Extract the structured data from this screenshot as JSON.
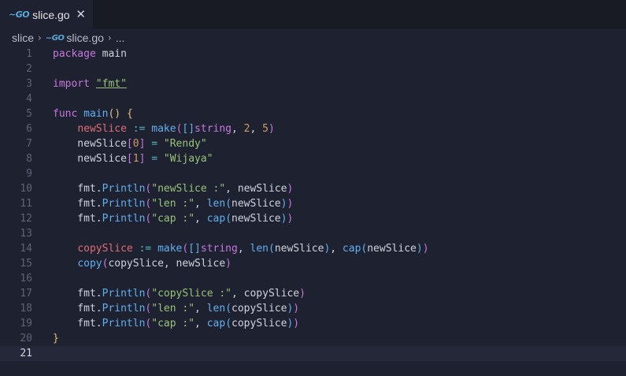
{
  "tab": {
    "icon": "go-file-icon",
    "title": "slice.go",
    "close": "✕"
  },
  "breadcrumb": {
    "folder": "slice",
    "file": "slice.go",
    "more": "..."
  },
  "editor": {
    "current_line": 21,
    "lines": [
      {
        "n": "1",
        "tokens": [
          [
            "kw",
            "package"
          ],
          [
            "pl",
            " main"
          ]
        ]
      },
      {
        "n": "2",
        "tokens": []
      },
      {
        "n": "3",
        "tokens": [
          [
            "kw",
            "import"
          ],
          [
            "pl",
            " "
          ],
          [
            "str",
            "\"fmt\""
          ]
        ]
      },
      {
        "n": "4",
        "tokens": []
      },
      {
        "n": "5",
        "tokens": [
          [
            "kw",
            "func"
          ],
          [
            "pl",
            " "
          ],
          [
            "fn",
            "main"
          ],
          [
            "paren",
            "()"
          ],
          [
            "pl",
            " "
          ],
          [
            "paren",
            "{"
          ]
        ]
      },
      {
        "n": "6",
        "tokens": [
          [
            "pl",
            "    "
          ],
          [
            "var",
            "newSlice"
          ],
          [
            "pl",
            " "
          ],
          [
            "op",
            ":="
          ],
          [
            "pl",
            " "
          ],
          [
            "fn",
            "make"
          ],
          [
            "br2",
            "("
          ],
          [
            "br3",
            "[]"
          ],
          [
            "kw",
            "string"
          ],
          [
            "pl",
            ", "
          ],
          [
            "num",
            "2"
          ],
          [
            "pl",
            ", "
          ],
          [
            "num",
            "5"
          ],
          [
            "br2",
            ")"
          ]
        ]
      },
      {
        "n": "7",
        "tokens": [
          [
            "pl",
            "    newSlice"
          ],
          [
            "br2",
            "["
          ],
          [
            "num",
            "0"
          ],
          [
            "br2",
            "]"
          ],
          [
            "pl",
            " "
          ],
          [
            "op",
            "="
          ],
          [
            "pl",
            " "
          ],
          [
            "str",
            "\"Rendy\""
          ]
        ]
      },
      {
        "n": "8",
        "tokens": [
          [
            "pl",
            "    newSlice"
          ],
          [
            "br2",
            "["
          ],
          [
            "num",
            "1"
          ],
          [
            "br2",
            "]"
          ],
          [
            "pl",
            " "
          ],
          [
            "op",
            "="
          ],
          [
            "pl",
            " "
          ],
          [
            "str",
            "\"Wijaya\""
          ]
        ]
      },
      {
        "n": "9",
        "tokens": []
      },
      {
        "n": "10",
        "tokens": [
          [
            "pl",
            "    fmt."
          ],
          [
            "fn",
            "Println"
          ],
          [
            "br2",
            "("
          ],
          [
            "str",
            "\"newSlice :\""
          ],
          [
            "pl",
            ", newSlice"
          ],
          [
            "br2",
            ")"
          ]
        ]
      },
      {
        "n": "11",
        "tokens": [
          [
            "pl",
            "    fmt."
          ],
          [
            "fn",
            "Println"
          ],
          [
            "br2",
            "("
          ],
          [
            "str",
            "\"len :\""
          ],
          [
            "pl",
            ", "
          ],
          [
            "fn",
            "len"
          ],
          [
            "br3",
            "("
          ],
          [
            "pl",
            "newSlice"
          ],
          [
            "br3",
            ")"
          ],
          [
            "br2",
            ")"
          ]
        ]
      },
      {
        "n": "12",
        "tokens": [
          [
            "pl",
            "    fmt."
          ],
          [
            "fn",
            "Println"
          ],
          [
            "br2",
            "("
          ],
          [
            "str",
            "\"cap :\""
          ],
          [
            "pl",
            ", "
          ],
          [
            "fn",
            "cap"
          ],
          [
            "br3",
            "("
          ],
          [
            "pl",
            "newSlice"
          ],
          [
            "br3",
            ")"
          ],
          [
            "br2",
            ")"
          ]
        ]
      },
      {
        "n": "13",
        "tokens": []
      },
      {
        "n": "14",
        "tokens": [
          [
            "pl",
            "    "
          ],
          [
            "var",
            "copySlice"
          ],
          [
            "pl",
            " "
          ],
          [
            "op",
            ":="
          ],
          [
            "pl",
            " "
          ],
          [
            "fn",
            "make"
          ],
          [
            "br2",
            "("
          ],
          [
            "br3",
            "[]"
          ],
          [
            "kw",
            "string"
          ],
          [
            "pl",
            ", "
          ],
          [
            "fn",
            "len"
          ],
          [
            "br3",
            "("
          ],
          [
            "pl",
            "newSlice"
          ],
          [
            "br3",
            ")"
          ],
          [
            "pl",
            ", "
          ],
          [
            "fn",
            "cap"
          ],
          [
            "br3",
            "("
          ],
          [
            "pl",
            "newSlice"
          ],
          [
            "br3",
            ")"
          ],
          [
            "br2",
            ")"
          ]
        ]
      },
      {
        "n": "15",
        "tokens": [
          [
            "pl",
            "    "
          ],
          [
            "fn",
            "copy"
          ],
          [
            "br2",
            "("
          ],
          [
            "pl",
            "copySlice, newSlice"
          ],
          [
            "br2",
            ")"
          ]
        ]
      },
      {
        "n": "16",
        "tokens": []
      },
      {
        "n": "17",
        "tokens": [
          [
            "pl",
            "    fmt."
          ],
          [
            "fn",
            "Println"
          ],
          [
            "br2",
            "("
          ],
          [
            "str",
            "\"copySlice :\""
          ],
          [
            "pl",
            ", copySlice"
          ],
          [
            "br2",
            ")"
          ]
        ]
      },
      {
        "n": "18",
        "tokens": [
          [
            "pl",
            "    fmt."
          ],
          [
            "fn",
            "Println"
          ],
          [
            "br2",
            "("
          ],
          [
            "str",
            "\"len :\""
          ],
          [
            "pl",
            ", "
          ],
          [
            "fn",
            "len"
          ],
          [
            "br3",
            "("
          ],
          [
            "pl",
            "copySlice"
          ],
          [
            "br3",
            ")"
          ],
          [
            "br2",
            ")"
          ]
        ]
      },
      {
        "n": "19",
        "tokens": [
          [
            "pl",
            "    fmt."
          ],
          [
            "fn",
            "Println"
          ],
          [
            "br2",
            "("
          ],
          [
            "str",
            "\"cap :\""
          ],
          [
            "pl",
            ", "
          ],
          [
            "fn",
            "cap"
          ],
          [
            "br3",
            "("
          ],
          [
            "pl",
            "copySlice"
          ],
          [
            "br3",
            ")"
          ],
          [
            "br2",
            ")"
          ]
        ]
      },
      {
        "n": "20",
        "tokens": [
          [
            "paren",
            "}"
          ]
        ]
      },
      {
        "n": "21",
        "tokens": []
      }
    ]
  }
}
